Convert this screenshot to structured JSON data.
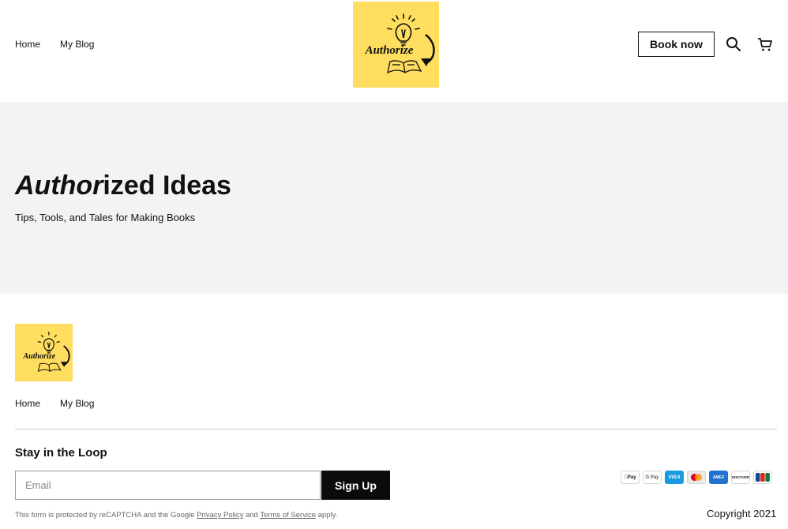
{
  "header": {
    "nav": [
      "Home",
      "My Blog"
    ],
    "logo_text": "Authorize",
    "book_label": "Book now",
    "search_icon": "search-icon",
    "cart_icon": "cart-icon"
  },
  "hero": {
    "title_italic": "Author",
    "title_rest": "ized Ideas",
    "subtitle": "Tips, Tools, and Tales for Making Books"
  },
  "footer": {
    "logo_text": "Authorize",
    "nav": [
      "Home",
      "My Blog"
    ],
    "newsletter_title": "Stay in the Loop",
    "email_placeholder": "Email",
    "signup_label": "Sign Up",
    "legal_prefix": "This form is protected by reCAPTCHA and the Google ",
    "privacy_link": "Privacy Policy",
    "legal_and": " and ",
    "terms_link": "Terms of Service",
    "legal_suffix": " apply.",
    "copyright": "Copyright 2021",
    "payment_methods": [
      {
        "label": "Pay",
        "icon": "apple-pay-icon"
      },
      {
        "label": "G Pay",
        "icon": "google-pay-icon"
      },
      {
        "label": "VISA",
        "icon": "visa-icon"
      },
      {
        "label": "",
        "icon": "mastercard-icon"
      },
      {
        "label": "AMEX",
        "icon": "amex-icon"
      },
      {
        "label": "DISCOVER",
        "icon": "discover-icon"
      },
      {
        "label": "JCB",
        "icon": "jcb-icon"
      }
    ]
  },
  "colors": {
    "logo_bg": "#FFDD5E",
    "hero_bg": "#F2F3F5",
    "button_dark": "#0B0B0B"
  }
}
